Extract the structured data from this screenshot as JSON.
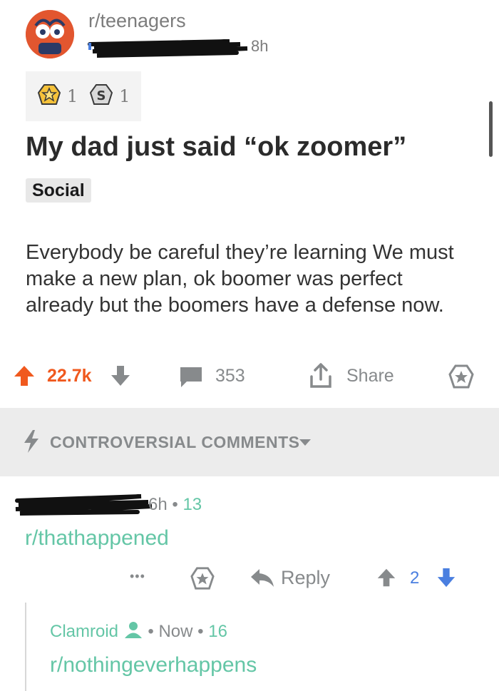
{
  "post": {
    "subreddit": "r/teenagers",
    "age": "8h",
    "awards": [
      {
        "icon": "gold-star-award-icon",
        "count": "1"
      },
      {
        "icon": "silver-s-award-icon",
        "count": "1"
      }
    ],
    "title": "My dad just said “ok zoomer”",
    "flair": "Social",
    "body": "Everybody be careful they’re learning We must make a new plan, ok boomer was perfect already but the boomers have a defense now.",
    "score": "22.7k",
    "comments_count": "353",
    "share_label": "Share"
  },
  "sort": {
    "label": "CONTROVERSIAL COMMENTS"
  },
  "comments": [
    {
      "age": "6h",
      "score": "13",
      "text": "r/thathappened",
      "reply_label": "Reply",
      "votes": "2",
      "more": "•••"
    },
    {
      "author": "Clamroid",
      "age": "Now",
      "score": "16",
      "text": "r/nothingeverhappens"
    }
  ],
  "colors": {
    "upvote_orange": "#f0591e",
    "comment_green": "#64c6a6",
    "vote_blue": "#4a7fe0",
    "grey_text": "#878a8c"
  }
}
